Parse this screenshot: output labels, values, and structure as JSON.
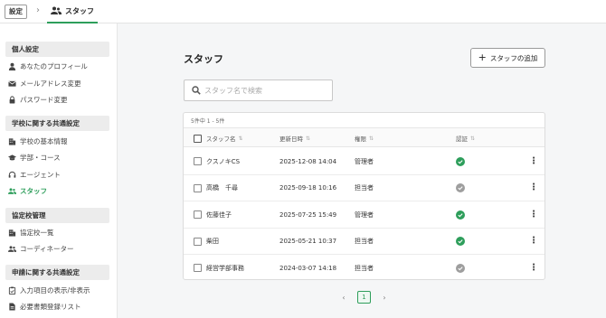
{
  "breadcrumb": {
    "settings": "設定",
    "separator": "›",
    "current": "スタッフ"
  },
  "sidebar": {
    "sections": [
      {
        "title": "個人設定",
        "items": [
          {
            "label": "あなたのプロフィール",
            "icon": "person-icon"
          },
          {
            "label": "メールアドレス変更",
            "icon": "mail-icon"
          },
          {
            "label": "パスワード変更",
            "icon": "lock-icon"
          }
        ]
      },
      {
        "title": "学校に関する共通設定",
        "items": [
          {
            "label": "学校の基本情報",
            "icon": "school-icon"
          },
          {
            "label": "学部・コース",
            "icon": "graduation-cap-icon"
          },
          {
            "label": "エージェント",
            "icon": "headset-icon"
          },
          {
            "label": "スタッフ",
            "icon": "group-icon",
            "active": true
          }
        ]
      },
      {
        "title": "協定校管理",
        "items": [
          {
            "label": "協定校一覧",
            "icon": "building-icon"
          },
          {
            "label": "コーディネーター",
            "icon": "group-icon"
          }
        ]
      },
      {
        "title": "申請に関する共通設定",
        "items": [
          {
            "label": "入力項目の表示/非表示",
            "icon": "clipboard-icon"
          },
          {
            "label": "必要書類登録リスト",
            "icon": "document-icon"
          }
        ]
      }
    ]
  },
  "main": {
    "title": "スタッフ",
    "add_button": "スタッフの追加",
    "search_placeholder": "スタッフ名で検索",
    "count_text": "5件中 1 - 5件",
    "columns": [
      "スタッフ名",
      "更新日時",
      "権限",
      "認証"
    ],
    "rows": [
      {
        "name": "クスノキCS",
        "updated": "2025-12-08 14:04",
        "role": "管理者",
        "verified": true
      },
      {
        "name": "高橋　千尋",
        "updated": "2025-09-18 10:16",
        "role": "担当者",
        "verified": false
      },
      {
        "name": "佐藤佳子",
        "updated": "2025-07-25 15:49",
        "role": "管理者",
        "verified": true
      },
      {
        "name": "柴田",
        "updated": "2025-05-21 10:37",
        "role": "担当者",
        "verified": true
      },
      {
        "name": "経営学部事務",
        "updated": "2024-03-07 14:18",
        "role": "担当者",
        "verified": false
      }
    ],
    "pagination": {
      "prev": "‹",
      "current": "1",
      "next": "›"
    }
  },
  "colors": {
    "accent": "#2e9e5b",
    "verified": "#2e9e5b",
    "unverified": "#9e9e9e"
  }
}
